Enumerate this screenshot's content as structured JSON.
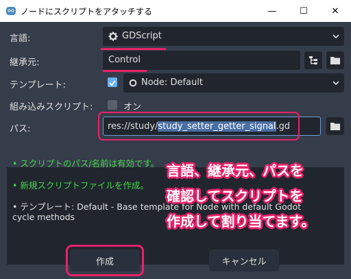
{
  "window": {
    "title": "ノードにスクリプトをアタッチする",
    "minimize_glyph": "—",
    "maximize_glyph": "☐",
    "close_glyph": "✕"
  },
  "form": {
    "language": {
      "label": "言語:",
      "value": "GDScript",
      "icon": "gear-icon"
    },
    "inherits": {
      "label": "継承元:",
      "value": "Control"
    },
    "template": {
      "label": "テンプレート:",
      "checked": true,
      "value": "Node: Default",
      "icon": "circle-icon"
    },
    "builtin": {
      "label": "組み込みスクリプト:",
      "checked": false,
      "value": "オン"
    },
    "path": {
      "label": "パス:",
      "prefix": "res://study/",
      "selected": "study_setter_getter_signal",
      "suffix": ".gd"
    }
  },
  "messages": [
    {
      "text": "• スクリプトのパス/名前は有効です。",
      "color": "#44d44a"
    },
    {
      "text": "• 新規スクリプトファイルを作成。",
      "color": "#44d44a"
    },
    {
      "text": "• テンプレート: Default - Base template for Node with default Godot",
      "color": "#e0e0e0"
    },
    {
      "text": "cycle methods",
      "color": "#e0e0e0"
    }
  ],
  "annotation": {
    "line1": "言語、継承元、パスを",
    "line2": "確認してスクリプトを",
    "line3": "作成して割り当てます。"
  },
  "buttons": {
    "create": "作成",
    "cancel": "キャンセル"
  },
  "colors": {
    "background": "#363d4a",
    "field": "#21262e",
    "accent": "#e8226a",
    "valid": "#44d44a",
    "selection": "#4a6fa5"
  }
}
